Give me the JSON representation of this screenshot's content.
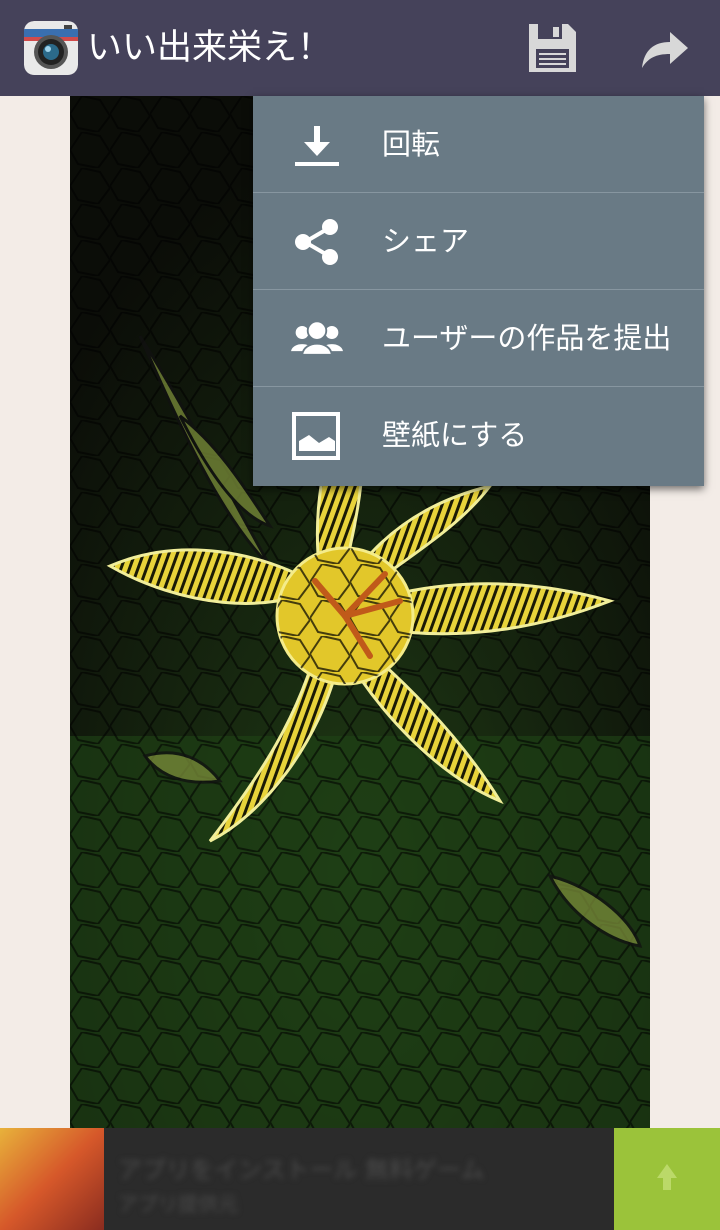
{
  "appbar": {
    "title": "いい出来栄え！",
    "app_icon": "camera-icon",
    "actions": [
      {
        "name": "save",
        "icon": "floppy-disk-icon"
      },
      {
        "name": "share",
        "icon": "share-arrow-icon"
      }
    ],
    "background": "#45425a"
  },
  "menu": {
    "background": "#697a85",
    "items": [
      {
        "label": "回転",
        "icon": "download-icon"
      },
      {
        "label": "シェア",
        "icon": "share-nodes-icon"
      },
      {
        "label": "ユーザーの作品を提出",
        "icon": "users-group-icon"
      },
      {
        "label": "壁紙にする",
        "icon": "image-icon"
      }
    ]
  },
  "photo": {
    "description_icon": "stained-glass-lily-image"
  },
  "ad": {
    "title": "アプリをインストール 無料ゲーム",
    "subtitle": "アプリ提供元",
    "cta_color": "#9bc33a"
  }
}
